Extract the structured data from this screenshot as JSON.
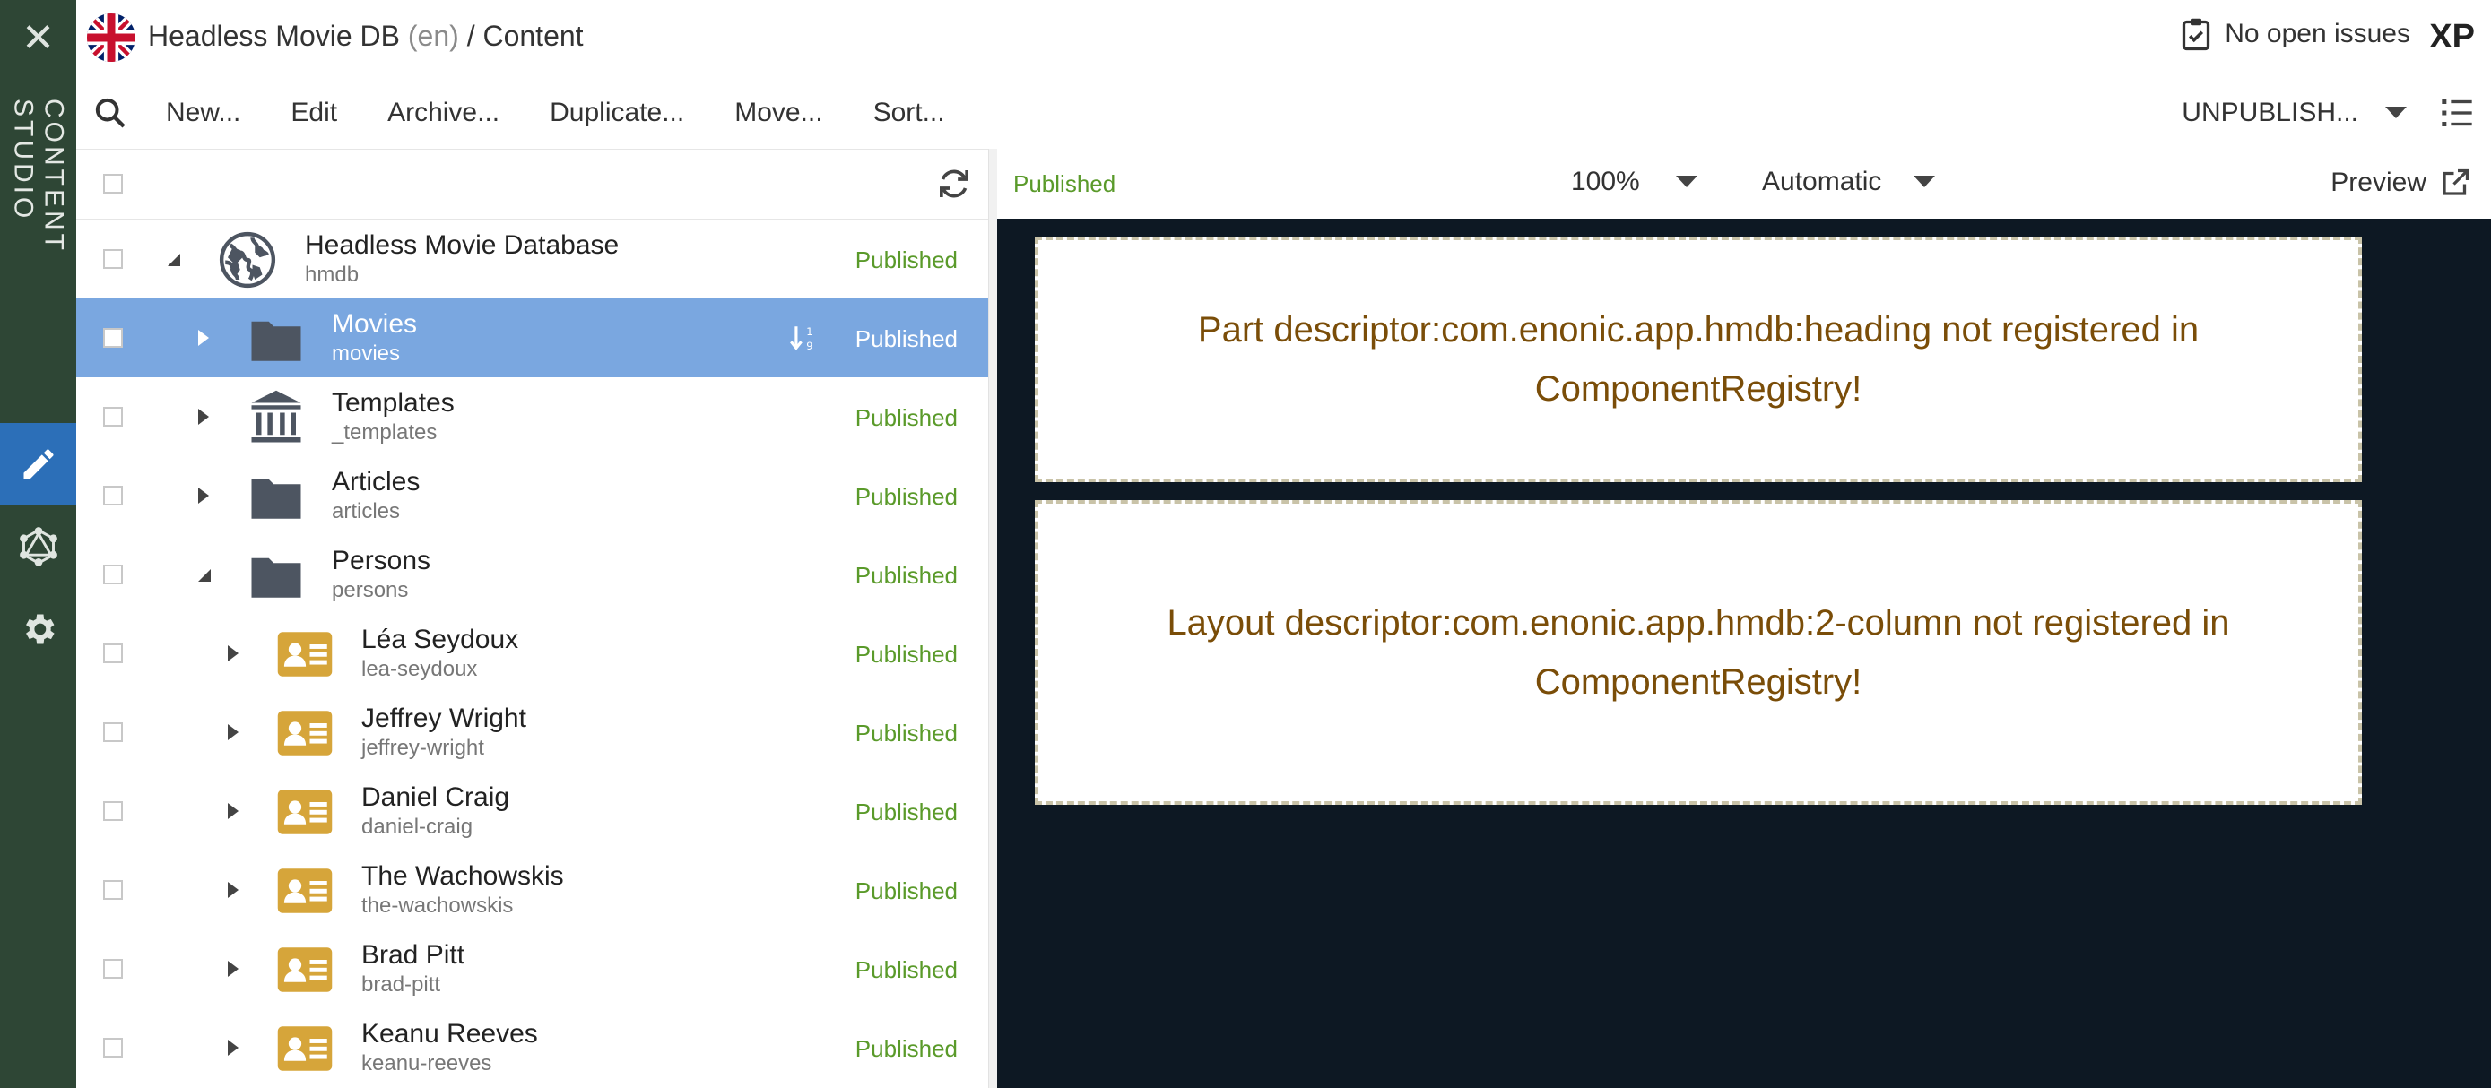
{
  "app": {
    "close_glyph": "✕",
    "rail_title": "CONTENT STUDIO",
    "project": "Headless Movie DB",
    "language": "(en)",
    "separator": "/",
    "section": "Content",
    "issues": "No open issues",
    "brand": "XP"
  },
  "toolbar": {
    "new": "New...",
    "edit": "Edit",
    "archive": "Archive...",
    "duplicate": "Duplicate...",
    "move": "Move...",
    "sort": "Sort...",
    "unpublish": "UNPUBLISH..."
  },
  "tree": [
    {
      "name": "Headless Movie Database",
      "path": "hmdb",
      "status": "Published",
      "icon": "globe-icon",
      "expanded": true
    },
    {
      "name": "Movies",
      "path": "movies",
      "status": "Published",
      "icon": "folder-icon",
      "selected": true
    },
    {
      "name": "Templates",
      "path": "_templates",
      "status": "Published",
      "icon": "templates-icon"
    },
    {
      "name": "Articles",
      "path": "articles",
      "status": "Published",
      "icon": "folder-icon"
    },
    {
      "name": "Persons",
      "path": "persons",
      "status": "Published",
      "icon": "folder-icon",
      "expanded": true
    },
    {
      "name": "Léa Seydoux",
      "path": "lea-seydoux",
      "status": "Published",
      "icon": "person-card-icon"
    },
    {
      "name": "Jeffrey Wright",
      "path": "jeffrey-wright",
      "status": "Published",
      "icon": "person-card-icon"
    },
    {
      "name": "Daniel Craig",
      "path": "daniel-craig",
      "status": "Published",
      "icon": "person-card-icon"
    },
    {
      "name": "The Wachowskis",
      "path": "the-wachowskis",
      "status": "Published",
      "icon": "person-card-icon"
    },
    {
      "name": "Brad Pitt",
      "path": "brad-pitt",
      "status": "Published",
      "icon": "person-card-icon"
    },
    {
      "name": "Keanu Reeves",
      "path": "keanu-reeves",
      "status": "Published",
      "icon": "person-card-icon"
    }
  ],
  "preview": {
    "status": "Published",
    "zoom": "100%",
    "mode": "Automatic",
    "preview_label": "Preview",
    "messages": [
      "Part descriptor:com.enonic.app.hmdb:heading not registered in ComponentRegistry!",
      "Layout descriptor:com.enonic.app.hmdb:2-column not registered in ComponentRegistry!"
    ]
  },
  "colors": {
    "rail": "#2e4635",
    "accent": "#2c6fb8",
    "selected_row": "#7aa7e0",
    "published": "#5a9a2a",
    "canvas": "#0d1823",
    "error_text": "#7a4d08",
    "person_icon": "#d6a53a",
    "folder_icon": "#4d5561"
  }
}
